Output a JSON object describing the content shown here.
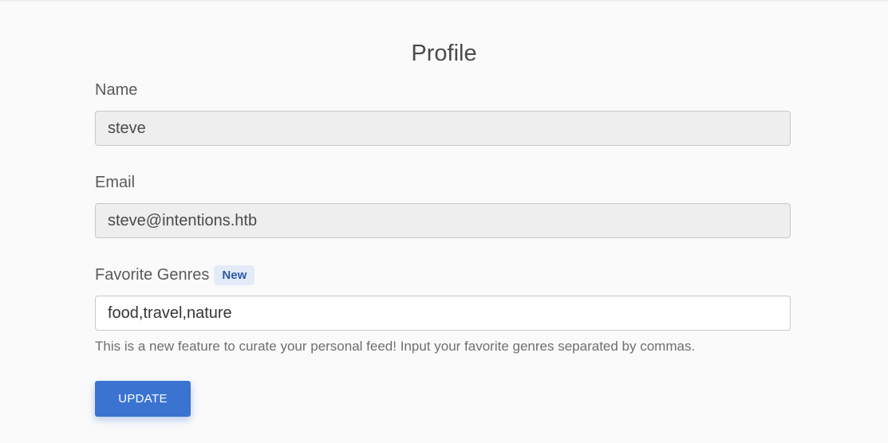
{
  "page": {
    "title": "Profile"
  },
  "form": {
    "name": {
      "label": "Name",
      "value": "steve"
    },
    "email": {
      "label": "Email",
      "value": "steve@intentions.htb"
    },
    "genres": {
      "label": "Favorite Genres",
      "badge": "New",
      "value": "food,travel,nature",
      "help": "This is a new feature to curate your personal feed! Input your favorite genres separated by commas."
    },
    "submit_label": "UPDATE"
  },
  "colors": {
    "background": "#fafafa",
    "primary_button": "#3b73d1",
    "badge_bg": "#e3ebf9",
    "badge_text": "#2d5aa8",
    "readonly_input_bg": "#eeeeee"
  }
}
